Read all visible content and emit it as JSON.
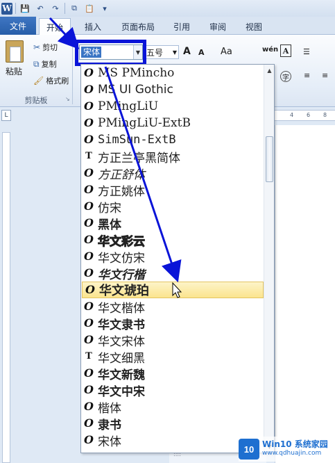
{
  "qat": {
    "logo_letter": "W",
    "icons": [
      "save-icon",
      "undo-icon",
      "redo-icon",
      "copy-icon",
      "paste-icon",
      "customize-icon"
    ]
  },
  "tabs": [
    {
      "label": "文件"
    },
    {
      "label": "开始"
    },
    {
      "label": "插入"
    },
    {
      "label": "页面布局"
    },
    {
      "label": "引用"
    },
    {
      "label": "审阅"
    },
    {
      "label": "视图"
    }
  ],
  "clipboard": {
    "paste_label": "粘贴",
    "cut_label": "剪切",
    "copy_label": "复制",
    "format_painter_label": "格式刷",
    "group_label": "剪贴板"
  },
  "font_combo": {
    "value": "宋体"
  },
  "size_combo": {
    "value": "五号"
  },
  "font_tools": {
    "grow": "A",
    "shrink": "A",
    "case": "Aa",
    "phonetic": "wén"
  },
  "ruler": {
    "corner": "L",
    "h_numbers": [
      "4",
      "6",
      "8"
    ]
  },
  "font_list": {
    "selected": "华文琥珀",
    "items": [
      {
        "name": "MS PMincho",
        "icon": "O"
      },
      {
        "name": "MS UI Gothic",
        "icon": "O"
      },
      {
        "name": "PMingLiU",
        "icon": "O"
      },
      {
        "name": "PMingLiU-ExtB",
        "icon": "O"
      },
      {
        "name": "SimSun-ExtB",
        "icon": "O"
      },
      {
        "name": "方正兰亭黑简体",
        "icon": "T"
      },
      {
        "name": "方正舒体",
        "icon": "O"
      },
      {
        "name": "方正姚体",
        "icon": "O"
      },
      {
        "name": "仿宋",
        "icon": "O"
      },
      {
        "name": "黑体",
        "icon": "O"
      },
      {
        "name": "华文彩云",
        "icon": "O"
      },
      {
        "name": "华文仿宋",
        "icon": "O"
      },
      {
        "name": "华文行楷",
        "icon": "O"
      },
      {
        "name": "华文琥珀",
        "icon": "O"
      },
      {
        "name": "华文楷体",
        "icon": "O"
      },
      {
        "name": "华文隶书",
        "icon": "O"
      },
      {
        "name": "华文宋体",
        "icon": "O"
      },
      {
        "name": "华文细黑",
        "icon": "T"
      },
      {
        "name": "华文新魏",
        "icon": "O"
      },
      {
        "name": "华文中宋",
        "icon": "O"
      },
      {
        "name": "楷体",
        "icon": "O"
      },
      {
        "name": "隶书",
        "icon": "O"
      },
      {
        "name": "宋体",
        "icon": "O"
      }
    ]
  },
  "watermark": {
    "logo": "10",
    "title": "Win10 系统家园",
    "url": "www.qdhuajin.com"
  },
  "annotation_color": "#0a14d8"
}
